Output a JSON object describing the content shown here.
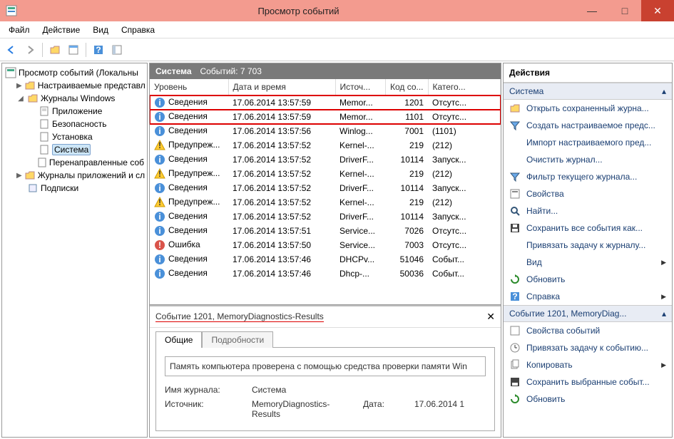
{
  "window": {
    "title": "Просмотр событий"
  },
  "menu": {
    "file": "Файл",
    "action": "Действие",
    "view": "Вид",
    "help": "Справка"
  },
  "tree": {
    "root": "Просмотр событий (Локальны",
    "custom_views": "Настраиваемые представл",
    "windows_logs": "Журналы Windows",
    "application": "Приложение",
    "security": "Безопасность",
    "setup": "Установка",
    "system": "Система",
    "forwarded": "Перенаправленные соб",
    "app_services": "Журналы приложений и сл",
    "subscriptions": "Подписки"
  },
  "main": {
    "title": "Система",
    "count_label": "Событий: 7 703",
    "columns": {
      "level": "Уровень",
      "datetime": "Дата и время",
      "source": "Источ...",
      "eventid": "Код со...",
      "category": "Катего..."
    },
    "rows": [
      {
        "icon": "info",
        "level": "Сведения",
        "dt": "17.06.2014 13:57:59",
        "src": "Memor...",
        "id": "1201",
        "cat": "Отсутс...",
        "hl": true
      },
      {
        "icon": "info",
        "level": "Сведения",
        "dt": "17.06.2014 13:57:59",
        "src": "Memor...",
        "id": "1101",
        "cat": "Отсутс...",
        "hl": true
      },
      {
        "icon": "info",
        "level": "Сведения",
        "dt": "17.06.2014 13:57:56",
        "src": "Winlog...",
        "id": "7001",
        "cat": "(1101)"
      },
      {
        "icon": "warn",
        "level": "Предупреж...",
        "dt": "17.06.2014 13:57:52",
        "src": "Kernel-...",
        "id": "219",
        "cat": "(212)"
      },
      {
        "icon": "info",
        "level": "Сведения",
        "dt": "17.06.2014 13:57:52",
        "src": "DriverF...",
        "id": "10114",
        "cat": "Запуск..."
      },
      {
        "icon": "warn",
        "level": "Предупреж...",
        "dt": "17.06.2014 13:57:52",
        "src": "Kernel-...",
        "id": "219",
        "cat": "(212)"
      },
      {
        "icon": "info",
        "level": "Сведения",
        "dt": "17.06.2014 13:57:52",
        "src": "DriverF...",
        "id": "10114",
        "cat": "Запуск..."
      },
      {
        "icon": "warn",
        "level": "Предупреж...",
        "dt": "17.06.2014 13:57:52",
        "src": "Kernel-...",
        "id": "219",
        "cat": "(212)"
      },
      {
        "icon": "info",
        "level": "Сведения",
        "dt": "17.06.2014 13:57:52",
        "src": "DriverF...",
        "id": "10114",
        "cat": "Запуск..."
      },
      {
        "icon": "info",
        "level": "Сведения",
        "dt": "17.06.2014 13:57:51",
        "src": "Service...",
        "id": "7026",
        "cat": "Отсутс..."
      },
      {
        "icon": "error",
        "level": "Ошибка",
        "dt": "17.06.2014 13:57:50",
        "src": "Service...",
        "id": "7003",
        "cat": "Отсутс..."
      },
      {
        "icon": "info",
        "level": "Сведения",
        "dt": "17.06.2014 13:57:46",
        "src": "DHCPv...",
        "id": "51046",
        "cat": "Событ..."
      },
      {
        "icon": "info",
        "level": "Сведения",
        "dt": "17.06.2014 13:57:46",
        "src": "Dhcp-...",
        "id": "50036",
        "cat": "Событ..."
      }
    ]
  },
  "detail": {
    "title": "Событие 1201, MemoryDiagnostics-Results",
    "tab_general": "Общие",
    "tab_details": "Подробности",
    "message": "Память компьютера проверена с помощью средства проверки памяти Win",
    "log_label": "Имя журнала:",
    "log_value": "Система",
    "source_label": "Источник:",
    "source_value": "MemoryDiagnostics-Results",
    "date_label": "Дата:",
    "date_value": "17.06.2014 1"
  },
  "actions": {
    "heading": "Действия",
    "section1": "Система",
    "open_saved": "Открыть сохраненный журна...",
    "create_view": "Создать настраиваемое предс...",
    "import_view": "Импорт настраиваемого пред...",
    "clear_log": "Очистить журнал...",
    "filter_log": "Фильтр текущего журнала...",
    "properties": "Свойства",
    "find": "Найти...",
    "save_all": "Сохранить все события как...",
    "attach_task": "Привязать задачу к журналу...",
    "view": "Вид",
    "refresh": "Обновить",
    "help": "Справка",
    "section2": "Событие 1201, MemoryDiag...",
    "event_props": "Свойства событий",
    "attach_event_task": "Привязать задачу к событию...",
    "copy": "Копировать",
    "save_selected": "Сохранить выбранные событ...",
    "refresh2": "Обновить"
  }
}
